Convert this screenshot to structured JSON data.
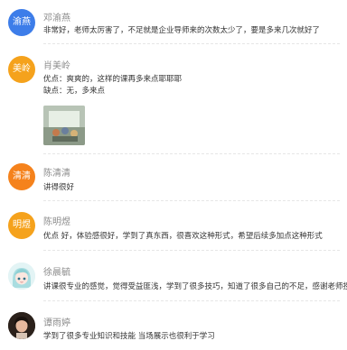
{
  "colors": {
    "blue_avatar": "#3d7de9",
    "orange_avatar": "#f5a21c",
    "name_gray": "#8c8c8c",
    "text_dark": "#333333"
  },
  "comments": [
    {
      "avatar_text": "渝燕",
      "avatar_color": "#3d7de9",
      "name": "邓渝燕",
      "lines": [
        "非常好，老师太厉害了，不足就是企业导师来的次数太少了，要是多来几次就好了"
      ]
    },
    {
      "avatar_text": "美岭",
      "avatar_color": "#f5a21c",
      "name": "肖美岭",
      "lines": [
        "优点：爽爽的，这样的课再多来点耶耶耶",
        "缺点：无，多来点"
      ],
      "has_image": true
    },
    {
      "avatar_text": "清清",
      "avatar_color": "#f5821c",
      "name": "陈清清",
      "lines": [
        "讲得很好"
      ]
    },
    {
      "avatar_text": "明煜",
      "avatar_color": "#f5a21c",
      "name": "陈明煜",
      "lines": [
        "优点 好，体验感很好，学到了真东西，很喜欢这种形式，希望后续多加点这种形式"
      ]
    },
    {
      "avatar_icon": "anime-girl-avatar-icon",
      "name": "徐晨毓",
      "lines": [
        "讲课很专业的感觉，觉得受益匪浅，学到了很多技巧，知道了很多自己的不足，感谢老师授课"
      ]
    },
    {
      "avatar_icon": "portrait-photo-avatar-icon",
      "name": "谭雨婷",
      "lines": [
        "学到了很多专业知识和技能 当场展示也很利于学习"
      ]
    }
  ]
}
